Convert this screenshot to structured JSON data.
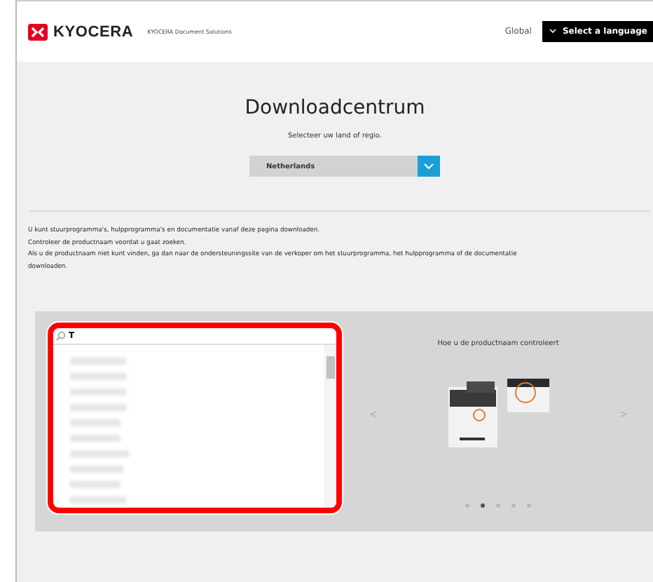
{
  "header": {
    "brand": "KYOCERA",
    "tagline": "KYOCERA Document Solutions",
    "region": "Global",
    "language_button": "Select a language"
  },
  "hero": {
    "title": "Downloadcentrum",
    "subtitle": "Selecteer uw land of regio.",
    "country_select": {
      "value": "Netherlands"
    }
  },
  "intro": [
    "U kunt stuurprogramma's, hulpprogramma's en documentatie vanaf deze pagina downloaden.",
    "Controleer de productnaam voordat u gaat zoeken.",
    "Als u de productnaam niet kunt vinden, ga dan naar de ondersteuningssite van de verkoper om het stuurprogramma, het hulpprogramma of de documentatie",
    "downloaden."
  ],
  "product_search": {
    "value": "T",
    "highlighted": true
  },
  "guide": {
    "title": "Hoe u de productnaam controleert",
    "prev": "<",
    "next": ">",
    "dots": [
      {
        "selected": false
      },
      {
        "selected": true
      },
      {
        "selected": false
      },
      {
        "selected": false
      },
      {
        "selected": false
      }
    ]
  }
}
